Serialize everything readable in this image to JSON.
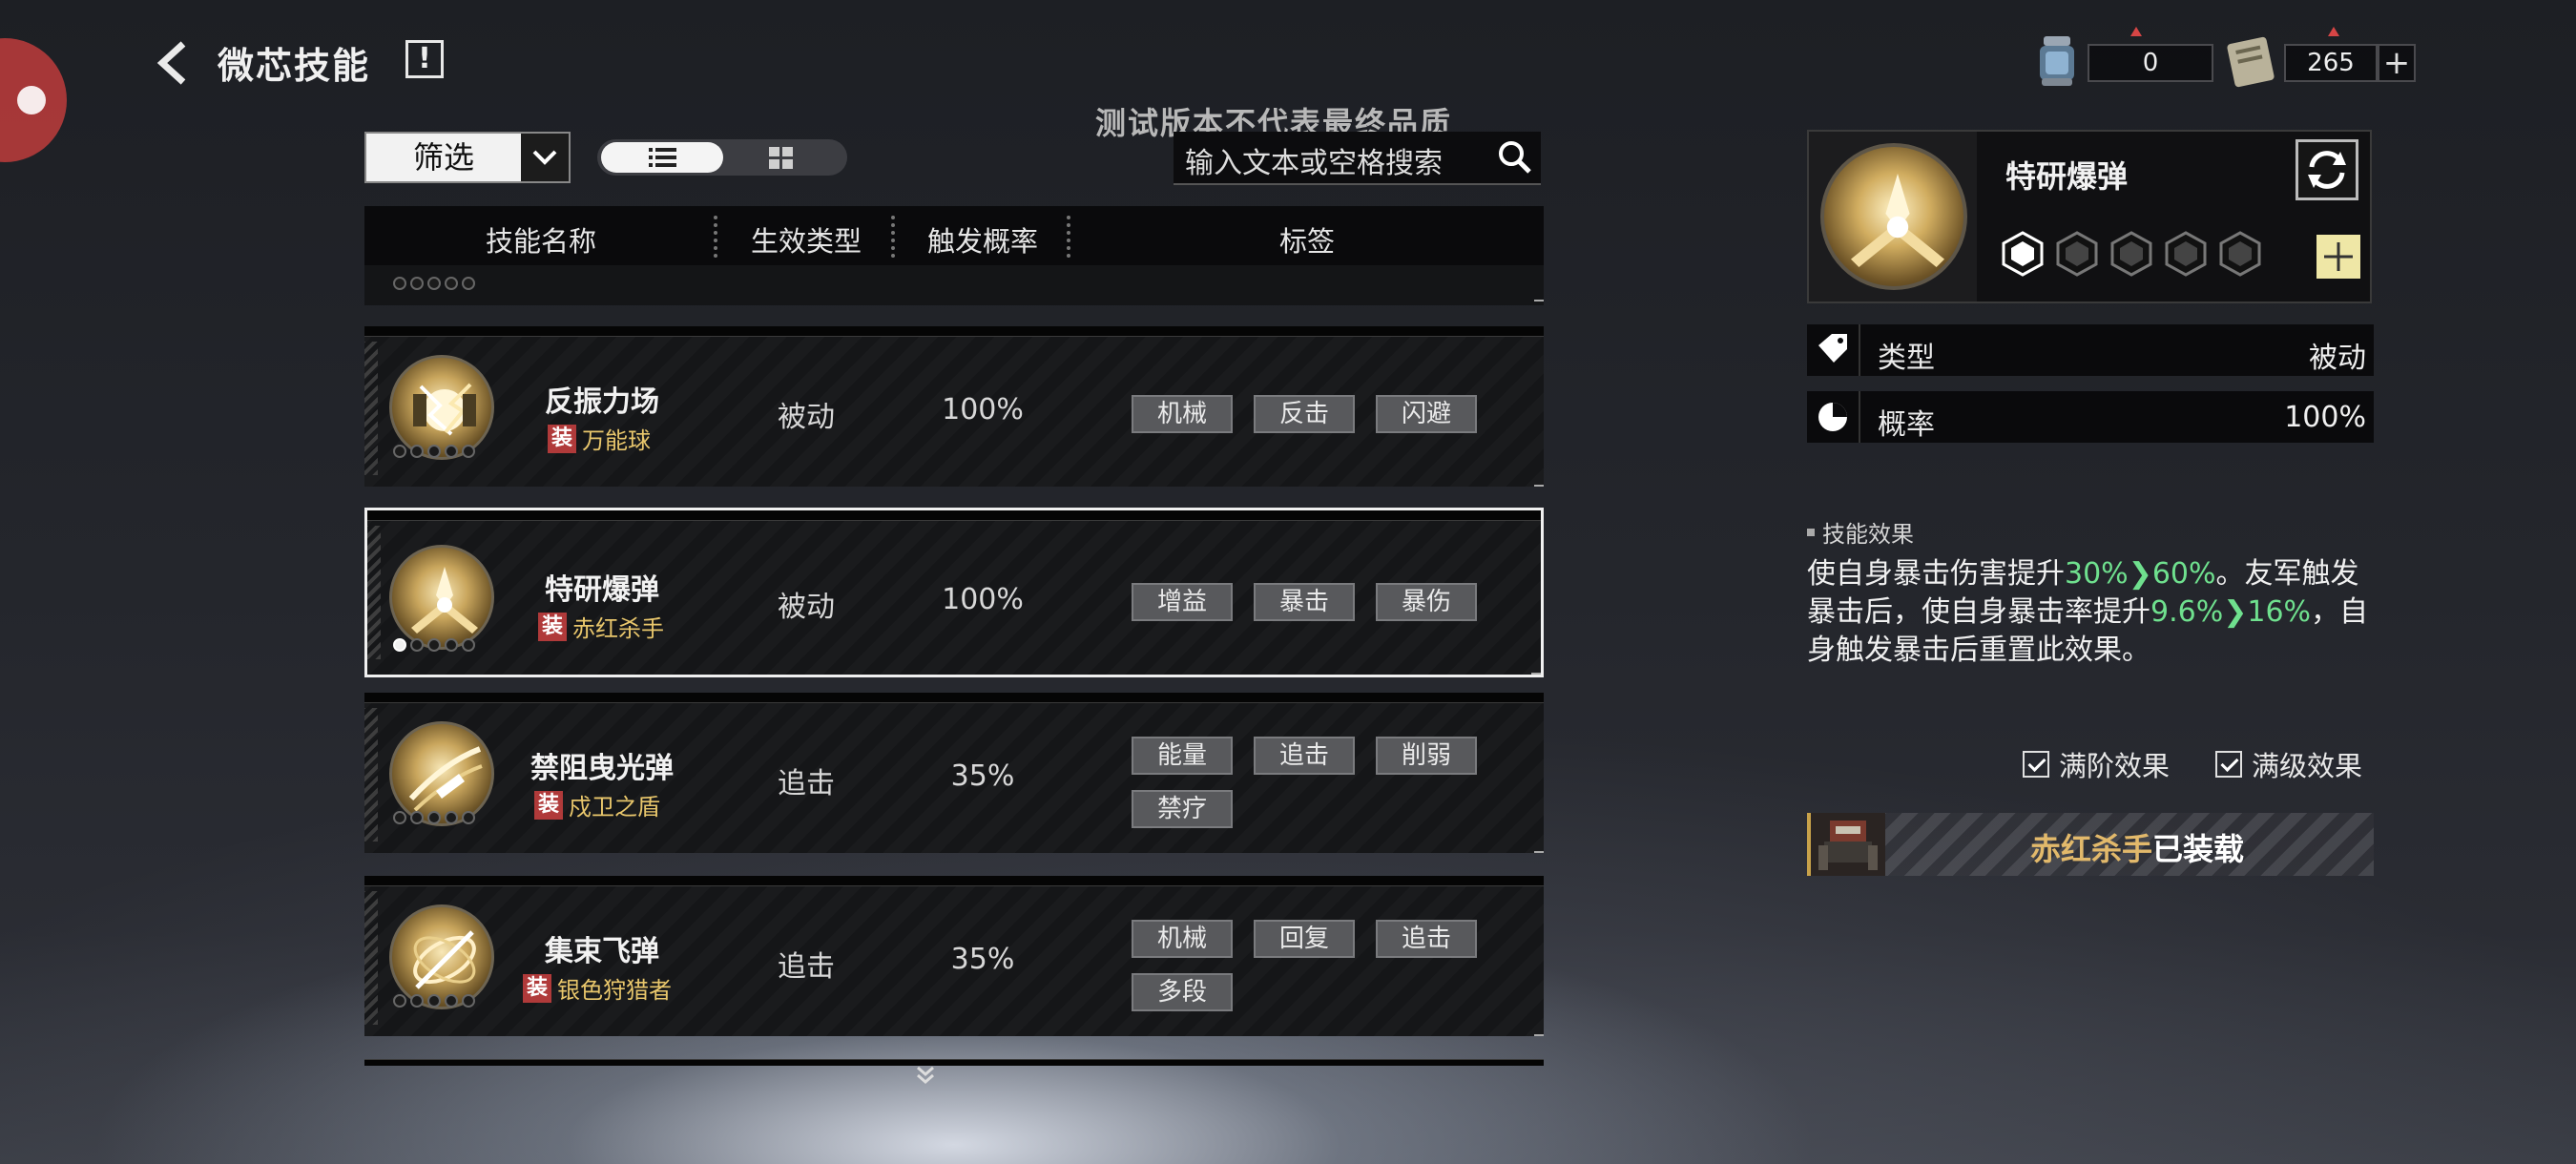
{
  "header": {
    "title": "微芯技能",
    "info_label": "!",
    "watermark": "测试版本不代表最终品质"
  },
  "currencies": [
    {
      "value": "0"
    },
    {
      "value": "265"
    }
  ],
  "toolbar": {
    "filter_label": "筛选",
    "search_placeholder": "输入文本或空格搜索"
  },
  "table": {
    "headers": {
      "name": "技能名称",
      "type": "生效类型",
      "rate": "触发概率",
      "tags": "标签"
    },
    "rows": [
      {
        "name": "反振力场",
        "equip_badge": "装",
        "equip_name": "万能球",
        "type": "被动",
        "rate": "100%",
        "tags": [
          "机械",
          "反击",
          "闪避"
        ]
      },
      {
        "name": "特研爆弹",
        "equip_badge": "装",
        "equip_name": "赤红杀手",
        "type": "被动",
        "rate": "100%",
        "tags": [
          "增益",
          "暴击",
          "暴伤"
        ]
      },
      {
        "name": "禁阻曳光弹",
        "equip_badge": "装",
        "equip_name": "戍卫之盾",
        "type": "追击",
        "rate": "35%",
        "tags": [
          "能量",
          "追击",
          "削弱",
          "禁疗"
        ]
      },
      {
        "name": "集束飞弹",
        "equip_badge": "装",
        "equip_name": "银色狩猎者",
        "type": "追击",
        "rate": "35%",
        "tags": [
          "机械",
          "回复",
          "追击",
          "多段"
        ]
      }
    ]
  },
  "detail": {
    "name": "特研爆弹",
    "stats": [
      {
        "label": "类型",
        "value": "被动"
      },
      {
        "label": "概率",
        "value": "100%"
      }
    ],
    "effect_header": "技能效果",
    "effect": {
      "p1": "使自身暴击伤害提升",
      "v1a": "30%",
      "v1b": "60%",
      "p2": "。友军触发暴击后，使自身暴击率提升",
      "v2a": "9.6%",
      "v2b": "16%",
      "p3": "，自身触发暴击后重置此效果。"
    },
    "checkboxes": [
      {
        "label": "满阶效果",
        "checked": true
      },
      {
        "label": "满级效果",
        "checked": true
      }
    ],
    "equipped": {
      "owner": "赤红杀手",
      "suffix": "已装载"
    }
  },
  "colors": {
    "accent_gold": "#e9c76c",
    "equip_red": "#b03a3a",
    "effect_green": "#6fe08e",
    "selection_border": "#f0f0f0"
  }
}
